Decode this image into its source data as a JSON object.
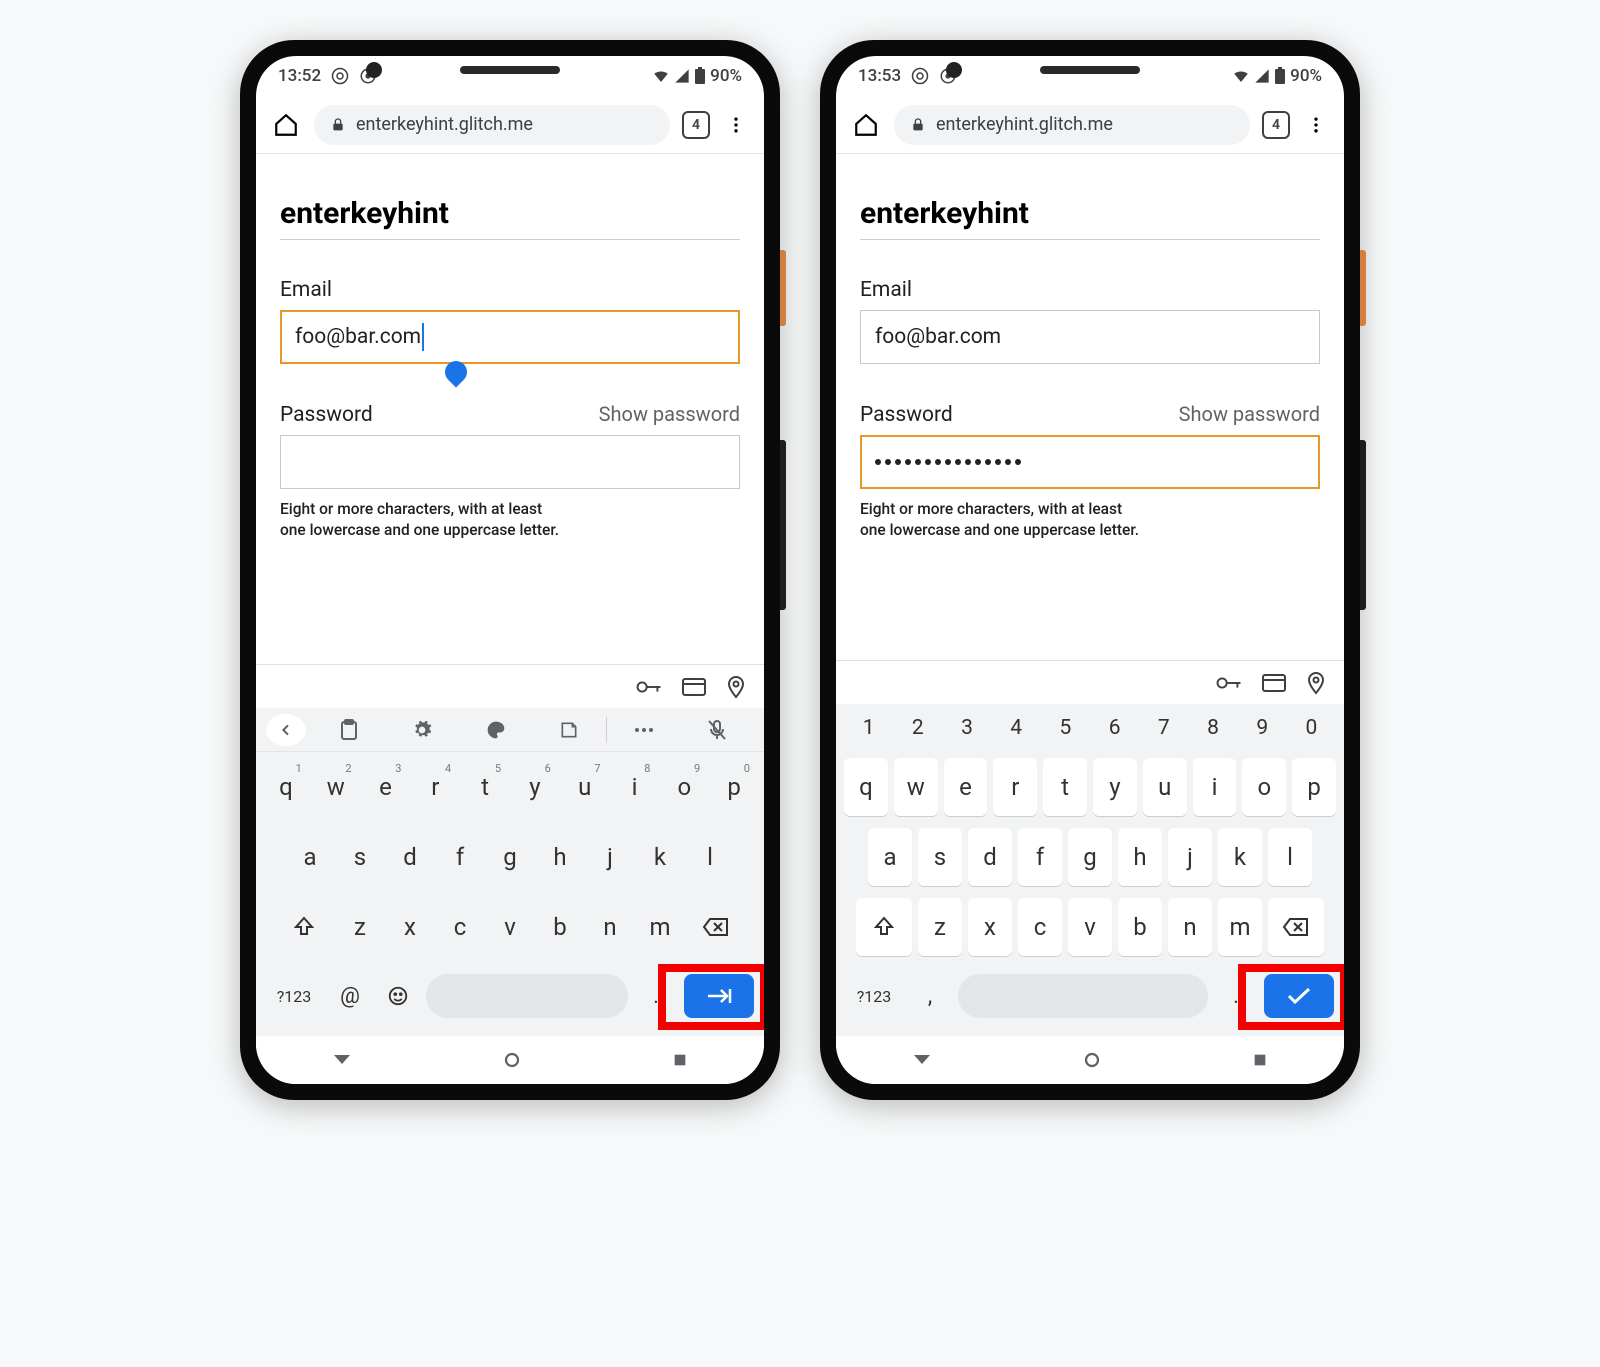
{
  "phones": [
    {
      "status": {
        "time": "13:52",
        "battery": "90%"
      },
      "browser": {
        "url": "enterkeyhint.glitch.me",
        "tabs": "4"
      },
      "page": {
        "title": "enterkeyhint",
        "email_label": "Email",
        "email_value": "foo@bar.com",
        "email_focused": true,
        "password_label": "Password",
        "show_password": "Show password",
        "password_value": "",
        "password_focused": false,
        "password_hint": "Eight or more characters, with at least\none lowercase and one uppercase letter."
      },
      "keyboard": {
        "toolbar": true,
        "numbers_row": false,
        "row1": [
          [
            "q",
            "1"
          ],
          [
            "w",
            "2"
          ],
          [
            "e",
            "3"
          ],
          [
            "r",
            "4"
          ],
          [
            "t",
            "5"
          ],
          [
            "y",
            "6"
          ],
          [
            "u",
            "7"
          ],
          [
            "i",
            "8"
          ],
          [
            "o",
            "9"
          ],
          [
            "p",
            "0"
          ]
        ],
        "row2": [
          "a",
          "s",
          "d",
          "f",
          "g",
          "h",
          "j",
          "k",
          "l"
        ],
        "row3": [
          "z",
          "x",
          "c",
          "v",
          "b",
          "n",
          "m"
        ],
        "bottom": {
          "sym": "?123",
          "extra1": "@",
          "extra2": "emoji",
          "period": ".",
          "enter": "next"
        }
      }
    },
    {
      "status": {
        "time": "13:53",
        "battery": "90%"
      },
      "browser": {
        "url": "enterkeyhint.glitch.me",
        "tabs": "4"
      },
      "page": {
        "title": "enterkeyhint",
        "email_label": "Email",
        "email_value": "foo@bar.com",
        "email_focused": false,
        "password_label": "Password",
        "show_password": "Show password",
        "password_value": "●●●●●●●●●●●●●●●",
        "password_focused": true,
        "password_hint": "Eight or more characters, with at least\none lowercase and one uppercase letter."
      },
      "keyboard": {
        "toolbar": false,
        "numbers_row": true,
        "numbers": [
          "1",
          "2",
          "3",
          "4",
          "5",
          "6",
          "7",
          "8",
          "9",
          "0"
        ],
        "row1": [
          [
            "q",
            ""
          ],
          [
            "w",
            ""
          ],
          [
            "e",
            ""
          ],
          [
            "r",
            ""
          ],
          [
            "t",
            ""
          ],
          [
            "y",
            ""
          ],
          [
            "u",
            ""
          ],
          [
            "i",
            ""
          ],
          [
            "o",
            ""
          ],
          [
            "p",
            ""
          ]
        ],
        "row2": [
          "a",
          "s",
          "d",
          "f",
          "g",
          "h",
          "j",
          "k",
          "l"
        ],
        "row3": [
          "z",
          "x",
          "c",
          "v",
          "b",
          "n",
          "m"
        ],
        "bottom": {
          "sym": "?123",
          "extra1": ",",
          "extra2": "",
          "period": ".",
          "enter": "done"
        }
      }
    }
  ]
}
